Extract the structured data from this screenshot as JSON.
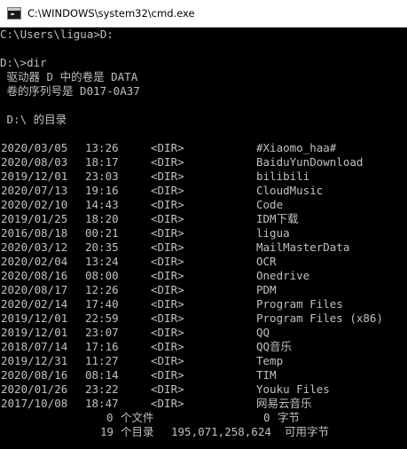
{
  "window": {
    "title": "C:\\WINDOWS\\system32\\cmd.exe",
    "icon": "command-prompt-icon"
  },
  "console": {
    "fg_color": "#c0c0c0",
    "bg_color": "#000000",
    "header_lines": [
      "C:\\Users\\ligua>D:",
      "",
      "D:\\>dir",
      " 驱动器 D 中的卷是 DATA",
      " 卷的序列号是 D017-0A37",
      "",
      " D:\\ 的目录",
      ""
    ],
    "entries": [
      {
        "date": "2020/03/05",
        "time": "13:26",
        "type": "<DIR>",
        "name": "#Xiaomo_haa#"
      },
      {
        "date": "2020/08/03",
        "time": "18:17",
        "type": "<DIR>",
        "name": "BaiduYunDownload"
      },
      {
        "date": "2019/12/01",
        "time": "23:03",
        "type": "<DIR>",
        "name": "bilibili"
      },
      {
        "date": "2020/07/13",
        "time": "19:16",
        "type": "<DIR>",
        "name": "CloudMusic"
      },
      {
        "date": "2020/02/10",
        "time": "14:43",
        "type": "<DIR>",
        "name": "Code"
      },
      {
        "date": "2019/01/25",
        "time": "18:20",
        "type": "<DIR>",
        "name": "IDM下载"
      },
      {
        "date": "2016/08/18",
        "time": "00:21",
        "type": "<DIR>",
        "name": "ligua"
      },
      {
        "date": "2020/03/12",
        "time": "20:35",
        "type": "<DIR>",
        "name": "MailMasterData"
      },
      {
        "date": "2020/02/04",
        "time": "13:24",
        "type": "<DIR>",
        "name": "OCR"
      },
      {
        "date": "2020/08/16",
        "time": "08:00",
        "type": "<DIR>",
        "name": "Onedrive"
      },
      {
        "date": "2020/08/17",
        "time": "12:26",
        "type": "<DIR>",
        "name": "PDM"
      },
      {
        "date": "2020/02/14",
        "time": "17:40",
        "type": "<DIR>",
        "name": "Program Files"
      },
      {
        "date": "2019/12/01",
        "time": "22:59",
        "type": "<DIR>",
        "name": "Program Files (x86)"
      },
      {
        "date": "2019/12/01",
        "time": "23:07",
        "type": "<DIR>",
        "name": "QQ"
      },
      {
        "date": "2018/07/14",
        "time": "17:16",
        "type": "<DIR>",
        "name": "QQ音乐"
      },
      {
        "date": "2019/12/31",
        "time": "11:27",
        "type": "<DIR>",
        "name": "Temp"
      },
      {
        "date": "2020/08/16",
        "time": "08:14",
        "type": "<DIR>",
        "name": "TIM"
      },
      {
        "date": "2020/01/26",
        "time": "23:22",
        "type": "<DIR>",
        "name": "Youku Files"
      },
      {
        "date": "2017/10/08",
        "time": "18:47",
        "type": "<DIR>",
        "name": "网易云音乐"
      }
    ],
    "summary": {
      "files_count": "0",
      "files_label": "个文件",
      "files_bytes": "0",
      "files_bytes_label": "字节",
      "dirs_count": "19",
      "dirs_label": "个目录",
      "dirs_free": "195,071,258,624",
      "dirs_free_label": "可用字节"
    }
  }
}
